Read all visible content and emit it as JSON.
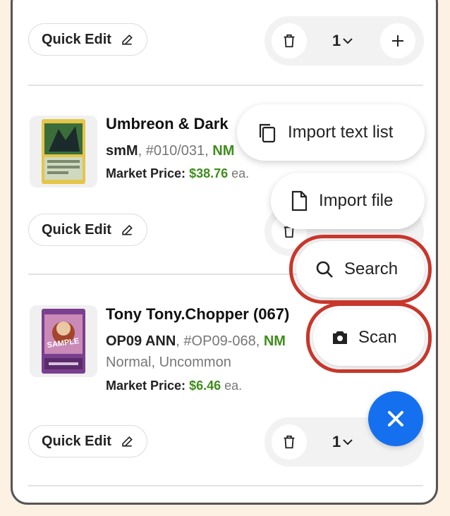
{
  "quick_edit_label": "Quick Edit",
  "items": [
    {
      "title": "Umbreon & Dark",
      "set": "smM",
      "number": "#010/031,",
      "condition": "NM",
      "price_label": "Market Price:",
      "price": "$38.76",
      "price_suffix": "ea."
    },
    {
      "title": "Tony Tony.Chopper (067)",
      "set": "OP09 ANN",
      "number": "#OP09-068,",
      "condition": "NM",
      "printing": "Normal",
      "rarity": "Uncommon",
      "price_label": "Market Price:",
      "price": "$6.46",
      "price_suffix": "ea."
    }
  ],
  "quantity_top": "1",
  "quantity_bottom": "1",
  "fab_menu": {
    "import_text": "Import text list",
    "import_file": "Import file",
    "search": "Search",
    "scan": "Scan"
  },
  "colors": {
    "accent": "#1570ef",
    "price_green": "#3f8d1c",
    "highlight_ring": "#c8362b"
  }
}
